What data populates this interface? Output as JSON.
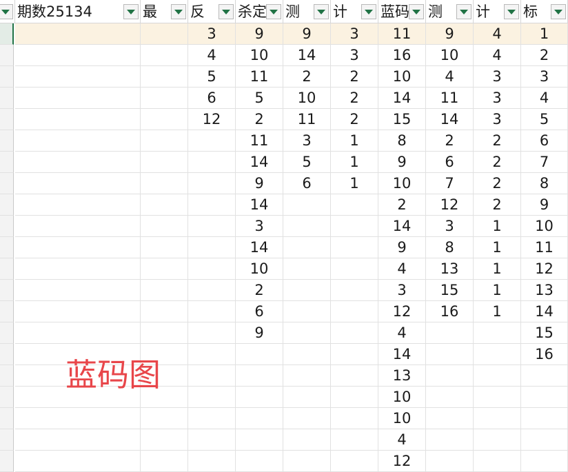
{
  "sheet": {
    "columns": [
      {
        "key": "A",
        "header": ""
      },
      {
        "key": "B",
        "header": "期数25134"
      },
      {
        "key": "C",
        "header": "最"
      },
      {
        "key": "D",
        "header": "反"
      },
      {
        "key": "E",
        "header": "杀定"
      },
      {
        "key": "F",
        "header": "测"
      },
      {
        "key": "G",
        "header": "计"
      },
      {
        "key": "H",
        "header": "蓝码"
      },
      {
        "key": "I",
        "header": "测"
      },
      {
        "key": "J",
        "header": "计"
      },
      {
        "key": "K",
        "header": "标"
      }
    ],
    "data_columns": {
      "D": [
        "3",
        "4",
        "5",
        "6",
        "12"
      ],
      "E": [
        "9",
        "10",
        "11",
        "5",
        "2",
        "11",
        "14",
        "9",
        "14",
        "3",
        "14",
        "10",
        "2",
        "6",
        "9"
      ],
      "F": [
        "9",
        "14",
        "2",
        "10",
        "11",
        "3",
        "5",
        "6"
      ],
      "G": [
        "3",
        "3",
        "2",
        "2",
        "2",
        "1",
        "1",
        "1"
      ],
      "H": [
        "11",
        "16",
        "10",
        "14",
        "15",
        "8",
        "9",
        "10",
        "2",
        "14",
        "9",
        "4",
        "3",
        "12",
        "4",
        "14",
        "13",
        "10",
        "10",
        "4",
        "12"
      ],
      "I": [
        "9",
        "10",
        "4",
        "11",
        "14",
        "2",
        "6",
        "7",
        "12",
        "3",
        "8",
        "13",
        "15",
        "16"
      ],
      "J": [
        "4",
        "4",
        "3",
        "3",
        "3",
        "2",
        "2",
        "2",
        "2",
        "1",
        "1",
        "1",
        "1",
        "1"
      ],
      "K": [
        "1",
        "2",
        "3",
        "4",
        "5",
        "6",
        "7",
        "8",
        "9",
        "10",
        "11",
        "12",
        "13",
        "14",
        "15",
        "16"
      ]
    },
    "highlight_row": 0,
    "highlight_color": "#fbf2e1",
    "filter_arrow_color": "#217346"
  },
  "overlay_text": "蓝码图",
  "overlay_color": "#e8464a"
}
